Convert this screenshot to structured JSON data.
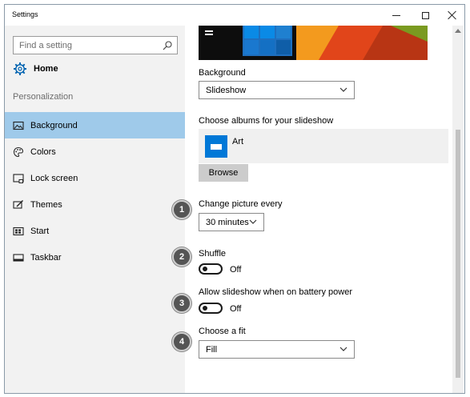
{
  "window": {
    "title": "Settings"
  },
  "sidebar": {
    "search_placeholder": "Find a setting",
    "home_label": "Home",
    "section_label": "Personalization",
    "items": [
      {
        "label": "Background",
        "icon": "picture-icon",
        "active": true
      },
      {
        "label": "Colors",
        "icon": "palette-icon",
        "active": false
      },
      {
        "label": "Lock screen",
        "icon": "lock-screen-icon",
        "active": false
      },
      {
        "label": "Themes",
        "icon": "brush-icon",
        "active": false
      },
      {
        "label": "Start",
        "icon": "start-icon",
        "active": false
      },
      {
        "label": "Taskbar",
        "icon": "taskbar-icon",
        "active": false
      }
    ]
  },
  "content": {
    "background_label": "Background",
    "background_value": "Slideshow",
    "albums_label": "Choose albums for your slideshow",
    "album_name": "Art",
    "browse_label": "Browse",
    "change_label": "Change picture every",
    "change_value": "30 minutes",
    "shuffle_label": "Shuffle",
    "shuffle_state": "Off",
    "battery_label": "Allow slideshow when on battery power",
    "battery_state": "Off",
    "fit_label": "Choose a fit",
    "fit_value": "Fill"
  },
  "callouts": [
    "1",
    "2",
    "3",
    "4"
  ],
  "colors": {
    "accent": "#0078d7",
    "active_nav": "#9fcaea",
    "sidebar_bg": "#f2f2f2",
    "callout_bg": "#555555"
  }
}
